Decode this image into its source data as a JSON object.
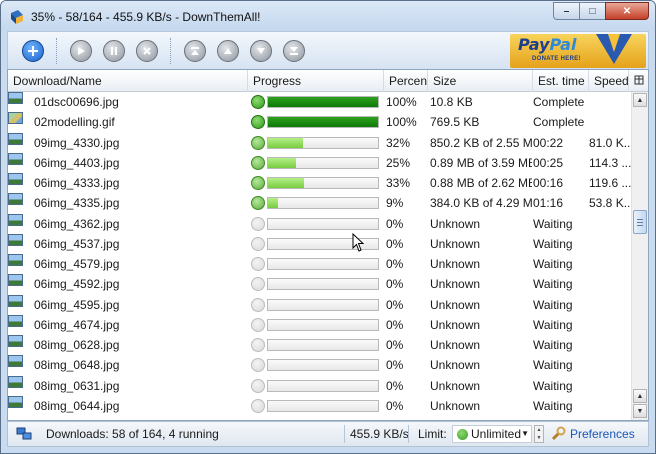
{
  "window": {
    "title": "35% - 58/164 - 455.9 KB/s - DownThemAll!",
    "controls": {
      "minimize": "–",
      "maximize": "□",
      "close": "✕"
    }
  },
  "toolbar": {
    "paypal": {
      "brand_a": "Pay",
      "brand_b": "Pal",
      "tagline": "DONATE HERE!"
    }
  },
  "columns": {
    "name": "Download/Name",
    "progress": "Progress",
    "percent": "Percent",
    "size": "Size",
    "time": "Est. time",
    "speed": "Speed"
  },
  "downloads": [
    {
      "name": "01dsc00696.jpg",
      "kind": "jpg",
      "state": "done",
      "progress": 1.0,
      "percent": "100%",
      "size": "10.8 KB",
      "time": "Complete",
      "speed": ""
    },
    {
      "name": "02modelling.gif",
      "kind": "gif",
      "state": "done",
      "progress": 1.0,
      "percent": "100%",
      "size": "769.5 KB",
      "time": "Complete",
      "speed": ""
    },
    {
      "name": "09img_4330.jpg",
      "kind": "jpg",
      "state": "running",
      "progress": 0.32,
      "percent": "32%",
      "size": "850.2 KB of 2.55 MB",
      "time": "00:22",
      "speed": "81.0 K..."
    },
    {
      "name": "06img_4403.jpg",
      "kind": "jpg",
      "state": "running",
      "progress": 0.25,
      "percent": "25%",
      "size": "0.89 MB of 3.59 MB",
      "time": "00:25",
      "speed": "114.3 ..."
    },
    {
      "name": "06img_4333.jpg",
      "kind": "jpg",
      "state": "running",
      "progress": 0.33,
      "percent": "33%",
      "size": "0.88 MB of 2.62 MB",
      "time": "00:16",
      "speed": "119.6 ..."
    },
    {
      "name": "06img_4335.jpg",
      "kind": "jpg",
      "state": "running",
      "progress": 0.09,
      "percent": "9%",
      "size": "384.0 KB of 4.29 MB",
      "time": "01:16",
      "speed": "53.8 K..."
    },
    {
      "name": "06img_4362.jpg",
      "kind": "jpg",
      "state": "waiting",
      "progress": 0,
      "percent": "0%",
      "size": "Unknown",
      "time": "Waiting",
      "speed": ""
    },
    {
      "name": "06img_4537.jpg",
      "kind": "jpg",
      "state": "waiting",
      "progress": 0,
      "percent": "0%",
      "size": "Unknown",
      "time": "Waiting",
      "speed": ""
    },
    {
      "name": "06img_4579.jpg",
      "kind": "jpg",
      "state": "waiting",
      "progress": 0,
      "percent": "0%",
      "size": "Unknown",
      "time": "Waiting",
      "speed": ""
    },
    {
      "name": "06img_4592.jpg",
      "kind": "jpg",
      "state": "waiting",
      "progress": 0,
      "percent": "0%",
      "size": "Unknown",
      "time": "Waiting",
      "speed": ""
    },
    {
      "name": "06img_4595.jpg",
      "kind": "jpg",
      "state": "waiting",
      "progress": 0,
      "percent": "0%",
      "size": "Unknown",
      "time": "Waiting",
      "speed": ""
    },
    {
      "name": "06img_4674.jpg",
      "kind": "jpg",
      "state": "waiting",
      "progress": 0,
      "percent": "0%",
      "size": "Unknown",
      "time": "Waiting",
      "speed": ""
    },
    {
      "name": "08img_0628.jpg",
      "kind": "jpg",
      "state": "waiting",
      "progress": 0,
      "percent": "0%",
      "size": "Unknown",
      "time": "Waiting",
      "speed": ""
    },
    {
      "name": "08img_0648.jpg",
      "kind": "jpg",
      "state": "waiting",
      "progress": 0,
      "percent": "0%",
      "size": "Unknown",
      "time": "Waiting",
      "speed": ""
    },
    {
      "name": "08img_0631.jpg",
      "kind": "jpg",
      "state": "waiting",
      "progress": 0,
      "percent": "0%",
      "size": "Unknown",
      "time": "Waiting",
      "speed": ""
    },
    {
      "name": "08img_0644.jpg",
      "kind": "jpg",
      "state": "waiting",
      "progress": 0,
      "percent": "0%",
      "size": "Unknown",
      "time": "Waiting",
      "speed": ""
    }
  ],
  "status": {
    "downloads": "Downloads: 58 of 164, 4 running",
    "speed": "455.9 KB/s",
    "limit_label": "Limit:",
    "limit_value": "Unlimited",
    "preferences": "Preferences"
  },
  "colors": {
    "accent": "#1c56b8",
    "complete_bar": "#0c7a06",
    "running_bar": "#78cc40"
  }
}
